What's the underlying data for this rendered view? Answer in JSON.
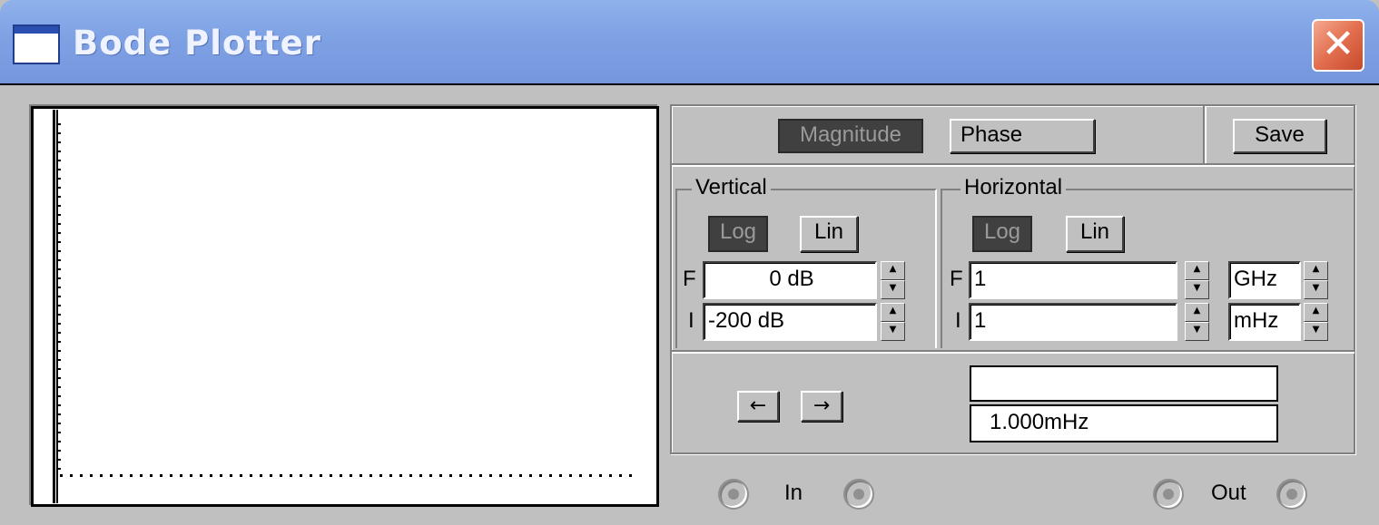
{
  "window": {
    "title": "Bode Plotter",
    "close_glyph": "✕",
    "icon": "window-icon"
  },
  "mode": {
    "magnitude_label": "Magnitude",
    "phase_label": "Phase",
    "save_label": "Save",
    "selected": "Magnitude"
  },
  "vertical": {
    "group_label": "Vertical",
    "log_label": "Log",
    "lin_label": "Lin",
    "selected": "Log",
    "final_label": "F",
    "final_value": "0 dB",
    "initial_label": "I",
    "initial_value": "-200 dB"
  },
  "horizontal": {
    "group_label": "Horizontal",
    "log_label": "Log",
    "lin_label": "Lin",
    "selected": "Log",
    "final_label": "F",
    "final_value": "1",
    "final_unit": "GHz",
    "initial_label": "I",
    "initial_value": "1",
    "initial_unit": "mHz"
  },
  "cursor": {
    "left_arrow": "←",
    "right_arrow": "→",
    "readout_top": "",
    "readout_bottom": "1.000mHz"
  },
  "terminals": {
    "in_label": "In",
    "out_label": "Out"
  },
  "spinner": {
    "up": "▲",
    "down": "▼"
  }
}
